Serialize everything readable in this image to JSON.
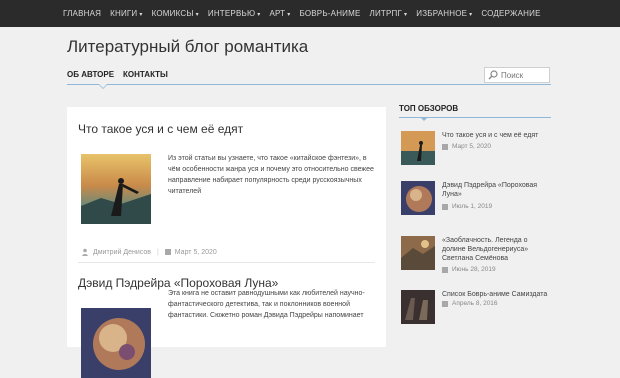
{
  "topnav": {
    "items": [
      {
        "label": "Главная",
        "caret": ""
      },
      {
        "label": "Книги",
        "caret": "▾"
      },
      {
        "label": "Комиксы",
        "caret": "▾"
      },
      {
        "label": "Интервью",
        "caret": "▾"
      },
      {
        "label": "Арт",
        "caret": "▾"
      },
      {
        "label": "Боврь-Аниме",
        "caret": ""
      },
      {
        "label": "ЛитРПГ",
        "caret": "▾"
      },
      {
        "label": "Избранное",
        "caret": "▾"
      },
      {
        "label": "Содержание",
        "caret": ""
      }
    ]
  },
  "header": {
    "site_title": "Литературный блог романтика",
    "subnav": [
      "Об авторе",
      "Контакты"
    ],
    "search_placeholder": "Поиск"
  },
  "posts": [
    {
      "title": "Что такое уся и с чем её едят",
      "excerpt": "Из этой статьи вы узнаете, что такое «китайское фэнтези», в чём особенности жанра уся и почему это относительно свежее направление набирает популярность среди русскоязычных читателей",
      "author": "Дмитрий Денисов",
      "date": "Март 5, 2020"
    },
    {
      "title": "Дэвид Пэдрейра «Пороховая Луна»",
      "excerpt": "Эта книга не оставит равнодушными как любителей научно-фантастического детектива, так и поклонников военной фантастики. Сюжетно роман Дэвида Пэдрейры напоминает"
    }
  ],
  "sidebar": {
    "title": "Топ обзоров",
    "items": [
      {
        "title": "Что такое уся и с чем её едят",
        "date": "Март 5, 2020"
      },
      {
        "title": "Дэвид Пэдрейра «Пороховая Луна»",
        "date": "Июль 1, 2019"
      },
      {
        "title": "«Заоблачность. Легенда о долине Вельдогенериуса» Светлана Семёнова",
        "date": "Июнь 28, 2019"
      },
      {
        "title": "Список Боврь-аниме Самиздата",
        "date": "Апрель 8, 2016"
      }
    ]
  },
  "colors": {
    "nav_bg": "#2b2b2b",
    "accent": "#8fb7d8",
    "page_bg": "#f0f0f0"
  }
}
